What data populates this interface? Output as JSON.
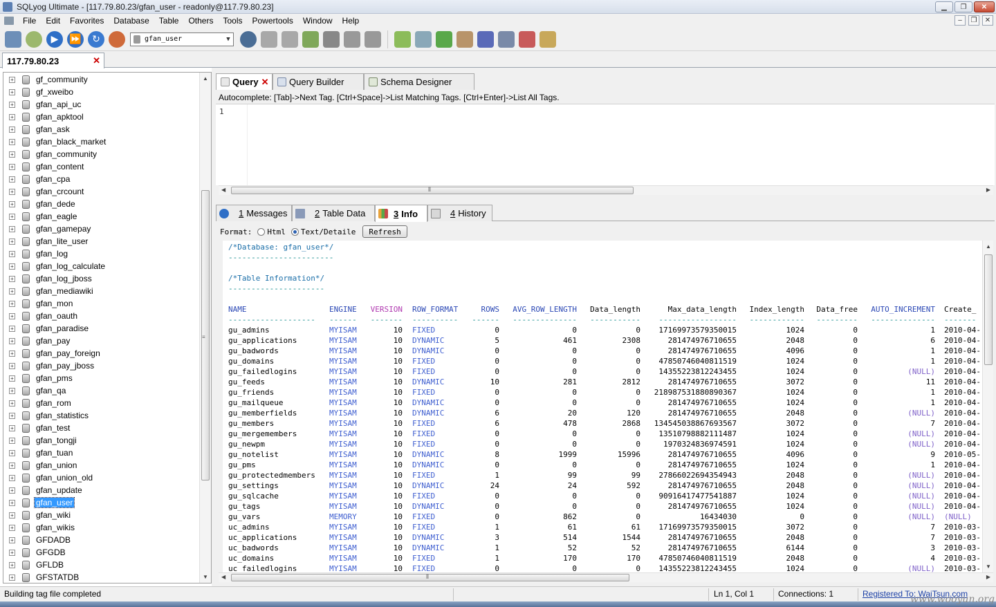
{
  "window": {
    "title": "SQLyog Ultimate - [117.79.80.23/gfan_user - readonly@117.79.80.23]",
    "min_label": "▁",
    "max_label": "❐",
    "close_label": "✕"
  },
  "menu": [
    "File",
    "Edit",
    "Favorites",
    "Database",
    "Table",
    "Others",
    "Tools",
    "Powertools",
    "Window",
    "Help"
  ],
  "toolbar": {
    "selected_db": "gfan_user",
    "icons": [
      "connect-icon",
      "new-connection-icon",
      "execute-icon",
      "execute-all-icon",
      "refresh-icon",
      "import-icon",
      "user-manager-icon",
      "create-db-icon",
      "create-table-icon",
      "backup-icon",
      "export-icon",
      "table-view-icon",
      "schema-icon",
      "sync-icon",
      "data-sync-icon",
      "migration-icon",
      "scheduler-icon",
      "notifications-icon",
      "query-profiler-icon",
      "designer-icon"
    ]
  },
  "connection_tab": {
    "label": "117.79.80.23",
    "close": "✕"
  },
  "databases": [
    "gf_community",
    "gf_xweibo",
    "gfan_api_uc",
    "gfan_apktool",
    "gfan_ask",
    "gfan_black_market",
    "gfan_community",
    "gfan_content",
    "gfan_cpa",
    "gfan_crcount",
    "gfan_dede",
    "gfan_eagle",
    "gfan_gamepay",
    "gfan_lite_user",
    "gfan_log",
    "gfan_log_calculate",
    "gfan_log_jboss",
    "gfan_mediawiki",
    "gfan_mon",
    "gfan_oauth",
    "gfan_paradise",
    "gfan_pay",
    "gfan_pay_foreign",
    "gfan_pay_jboss",
    "gfan_pms",
    "gfan_qa",
    "gfan_rom",
    "gfan_statistics",
    "gfan_test",
    "gfan_tongji",
    "gfan_tuan",
    "gfan_union",
    "gfan_union_old",
    "gfan_update",
    "gfan_user",
    "gfan_wiki",
    "gfan_wikis",
    "GFDADB",
    "GFGDB",
    "GFLDB",
    "GFSTATDB"
  ],
  "selected_database": "gfan_user",
  "editor_tabs": [
    {
      "label": "Query",
      "active": true,
      "close": "✕"
    },
    {
      "label": "Query Builder",
      "active": false
    },
    {
      "label": "Schema Designer",
      "active": false
    }
  ],
  "autocomplete_hint": "Autocomplete: [Tab]->Next Tag. [Ctrl+Space]->List Matching Tags. [Ctrl+Enter]->List All Tags.",
  "editor_line_number": "1",
  "result_tabs": [
    {
      "num": "1",
      "label": "Messages",
      "active": false
    },
    {
      "num": "2",
      "label": "Table Data",
      "active": false
    },
    {
      "num": "3",
      "label": "Info",
      "active": true
    },
    {
      "num": "4",
      "label": "History",
      "active": false
    }
  ],
  "format_bar": {
    "label": "Format:",
    "html_option": "Html",
    "text_option": "Text/Detaile",
    "selected": "Text/Detailed",
    "refresh": "Refresh"
  },
  "info": {
    "db_comment": "/*Database: gfan_user*/",
    "db_dash": "-----------------------",
    "table_comment": "/*Table Information*/",
    "table_dash": "---------------------",
    "columns": [
      "NAME",
      "ENGINE",
      "VERSION",
      "ROW_FORMAT",
      "ROWS",
      "AVG_ROW_LENGTH",
      "Data_length",
      "Max_data_length",
      "Index_length",
      "Data_free",
      "AUTO_INCREMENT",
      "Create_"
    ],
    "column_dashes": [
      "-------------------",
      "------",
      "-------",
      "----------",
      "------",
      "--------------",
      "-----------",
      "-----------------",
      "------------",
      "---------",
      "--------------",
      "-------"
    ],
    "rows": [
      [
        "gu_admins",
        "MYISAM",
        "10",
        "FIXED",
        "0",
        "0",
        "0",
        "17169973579350015",
        "1024",
        "0",
        "1",
        "2010-04-"
      ],
      [
        "gu_applications",
        "MYISAM",
        "10",
        "DYNAMIC",
        "5",
        "461",
        "2308",
        "281474976710655",
        "2048",
        "0",
        "6",
        "2010-04-"
      ],
      [
        "gu_badwords",
        "MYISAM",
        "10",
        "DYNAMIC",
        "0",
        "0",
        "0",
        "281474976710655",
        "4096",
        "0",
        "1",
        "2010-04-"
      ],
      [
        "gu_domains",
        "MYISAM",
        "10",
        "FIXED",
        "0",
        "0",
        "0",
        "47850746040811519",
        "1024",
        "0",
        "1",
        "2010-04-"
      ],
      [
        "gu_failedlogins",
        "MYISAM",
        "10",
        "FIXED",
        "0",
        "0",
        "0",
        "14355223812243455",
        "1024",
        "0",
        "(NULL)",
        "2010-04-"
      ],
      [
        "gu_feeds",
        "MYISAM",
        "10",
        "DYNAMIC",
        "10",
        "281",
        "2812",
        "281474976710655",
        "3072",
        "0",
        "11",
        "2010-04-"
      ],
      [
        "gu_friends",
        "MYISAM",
        "10",
        "FIXED",
        "0",
        "0",
        "0",
        "218987531880890367",
        "1024",
        "0",
        "1",
        "2010-04-"
      ],
      [
        "gu_mailqueue",
        "MYISAM",
        "10",
        "DYNAMIC",
        "0",
        "0",
        "0",
        "281474976710655",
        "1024",
        "0",
        "1",
        "2010-04-"
      ],
      [
        "gu_memberfields",
        "MYISAM",
        "10",
        "DYNAMIC",
        "6",
        "20",
        "120",
        "281474976710655",
        "2048",
        "0",
        "(NULL)",
        "2010-04-"
      ],
      [
        "gu_members",
        "MYISAM",
        "10",
        "FIXED",
        "6",
        "478",
        "2868",
        "134545038867693567",
        "3072",
        "0",
        "7",
        "2010-04-"
      ],
      [
        "gu_mergemembers",
        "MYISAM",
        "10",
        "FIXED",
        "0",
        "0",
        "0",
        "13510798882111487",
        "1024",
        "0",
        "(NULL)",
        "2010-04-"
      ],
      [
        "gu_newpm",
        "MYISAM",
        "10",
        "FIXED",
        "0",
        "0",
        "0",
        "1970324836974591",
        "1024",
        "0",
        "(NULL)",
        "2010-04-"
      ],
      [
        "gu_notelist",
        "MYISAM",
        "10",
        "DYNAMIC",
        "8",
        "1999",
        "15996",
        "281474976710655",
        "4096",
        "0",
        "9",
        "2010-05-"
      ],
      [
        "gu_pms",
        "MYISAM",
        "10",
        "DYNAMIC",
        "0",
        "0",
        "0",
        "281474976710655",
        "1024",
        "0",
        "1",
        "2010-04-"
      ],
      [
        "gu_protectedmembers",
        "MYISAM",
        "10",
        "FIXED",
        "1",
        "99",
        "99",
        "27866022694354943",
        "2048",
        "0",
        "(NULL)",
        "2010-04-"
      ],
      [
        "gu_settings",
        "MYISAM",
        "10",
        "DYNAMIC",
        "24",
        "24",
        "592",
        "281474976710655",
        "2048",
        "0",
        "(NULL)",
        "2010-04-"
      ],
      [
        "gu_sqlcache",
        "MYISAM",
        "10",
        "FIXED",
        "0",
        "0",
        "0",
        "90916417477541887",
        "1024",
        "0",
        "(NULL)",
        "2010-04-"
      ],
      [
        "gu_tags",
        "MYISAM",
        "10",
        "DYNAMIC",
        "0",
        "0",
        "0",
        "281474976710655",
        "1024",
        "0",
        "(NULL)",
        "2010-04-"
      ],
      [
        "gu_vars",
        "MEMORY",
        "10",
        "FIXED",
        "0",
        "862",
        "0",
        "16434030",
        "0",
        "0",
        "(NULL)",
        "(NULL)"
      ],
      [
        "uc_admins",
        "MYISAM",
        "10",
        "FIXED",
        "1",
        "61",
        "61",
        "17169973579350015",
        "3072",
        "0",
        "7",
        "2010-03-"
      ],
      [
        "uc_applications",
        "MYISAM",
        "10",
        "DYNAMIC",
        "3",
        "514",
        "1544",
        "281474976710655",
        "2048",
        "0",
        "7",
        "2010-03-"
      ],
      [
        "uc_badwords",
        "MYISAM",
        "10",
        "DYNAMIC",
        "1",
        "52",
        "52",
        "281474976710655",
        "6144",
        "0",
        "3",
        "2010-03-"
      ],
      [
        "uc_domains",
        "MYISAM",
        "10",
        "FIXED",
        "1",
        "170",
        "170",
        "47850746040811519",
        "2048",
        "0",
        "4",
        "2010-03-"
      ],
      [
        "uc_failedlogins",
        "MYISAM",
        "10",
        "FIXED",
        "0",
        "0",
        "0",
        "14355223812243455",
        "1024",
        "0",
        "(NULL)",
        "2010-03-"
      ]
    ]
  },
  "status": {
    "message": "Building tag file completed",
    "position": "Ln 1, Col 1",
    "connections": "Connections: 1",
    "registered": "Registered To: WaiTsun.com"
  },
  "watermark": "www.wooyun.org",
  "colors": {
    "selection": "#3399ff",
    "link": "#1a3fa6",
    "comment": "#1a6ea8",
    "keyword": "#3f5fd0"
  }
}
